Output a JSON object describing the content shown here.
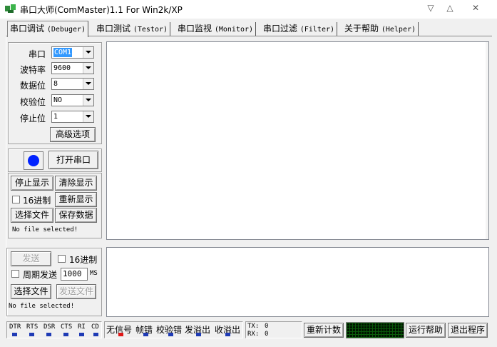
{
  "window": {
    "title": "串口大师(ComMaster)1.1 For Win2k/XP",
    "minimize": "▽",
    "maximize": "△",
    "close": "✕"
  },
  "tabs": [
    {
      "cn": "串口调试",
      "en": "(Debuger)"
    },
    {
      "cn": "串口测试",
      "en": "(Testor)"
    },
    {
      "cn": "串口监视",
      "en": "(Monitor)"
    },
    {
      "cn": "串口过滤",
      "en": "(Filter)"
    },
    {
      "cn": "关于帮助",
      "en": "(Helper)"
    }
  ],
  "settings": {
    "port_label": "串口",
    "port_value": "COM1",
    "baud_label": "波特率",
    "baud_value": "9600",
    "databits_label": "数据位",
    "databits_value": "8",
    "parity_label": "校验位",
    "parity_value": "NO",
    "stopbits_label": "停止位",
    "stopbits_value": "1",
    "advanced_label": "高级选项"
  },
  "port_control": {
    "open_label": "打开串口",
    "indicator_color": "#0022ff"
  },
  "receive": {
    "stop_display": "停止显示",
    "clear_display": "清除显示",
    "hex_label": "16进制",
    "redisplay": "重新显示",
    "select_file": "选择文件",
    "save_data": "保存数据",
    "file_status": "No file selected!"
  },
  "send": {
    "send_label": "发送",
    "hex_label": "16进制",
    "periodic_label": "周期发送",
    "period_value": "1000",
    "period_unit": "MS",
    "select_file": "选择文件",
    "send_file": "发送文件",
    "file_status": "No file selected!"
  },
  "status": {
    "signals": [
      "DTR",
      "RTS",
      "DSR",
      "CTS",
      "RI",
      "CD"
    ],
    "errors": [
      {
        "label": "无信号",
        "color": "#e01818"
      },
      {
        "label": "帧错",
        "color": "#1f3bb5"
      },
      {
        "label": "校验错",
        "color": "#1f3bb5"
      },
      {
        "label": "发溢出",
        "color": "#1f3bb5"
      },
      {
        "label": "收溢出",
        "color": "#1f3bb5"
      }
    ],
    "tx_label": "TX:",
    "tx_value": "0",
    "rx_label": "RX:",
    "rx_value": "0",
    "reset_count": "重新计数",
    "help": "运行帮助",
    "exit": "退出程序"
  }
}
